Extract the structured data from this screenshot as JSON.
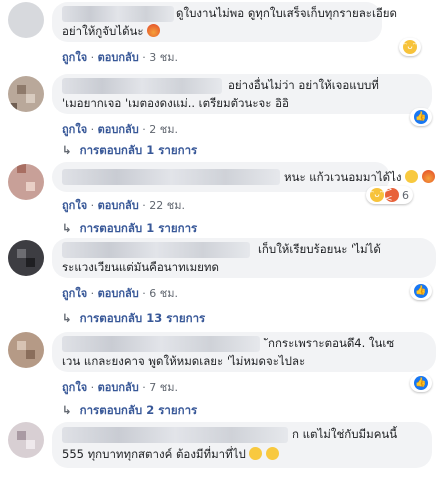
{
  "colors": {
    "link": "#385898",
    "bubble": "#f2f3f5",
    "meta": "#616770",
    "like": "#1877f2"
  },
  "comments": [
    {
      "text_lines": [
        "ดูใบงานไม่พอ ดูทุกใบเสร็จเก็บทุกรายละเอียด",
        "อย่าให้กูจับได้นะ"
      ],
      "like": "ถูกใจ",
      "reply": "ตอบกลับ",
      "time": "3 ชม.",
      "reaction_icons": [
        "haha-icon"
      ],
      "reaction_count": ""
    },
    {
      "text_lines": [
        "อย่างอื่นไม่ว่า อย่าให้เจอแบบที่",
        "'เมอยากเจอ 'เมตองดงแม่.. เตรียมตัวนะจะ อิอิ"
      ],
      "like": "ถูกใจ",
      "reply": "ตอบกลับ",
      "time": "2 ชม.",
      "reaction_icons": [
        "like-icon"
      ],
      "reaction_count": "",
      "replies": "การตอบกลับ 1 รายการ"
    },
    {
      "text_lines": [
        "หนะ แก้วเวนอมมาได้ไง"
      ],
      "like": "ถูกใจ",
      "reply": "ตอบกลับ",
      "time": "22 ชม.",
      "reaction_icons": [
        "haha-icon",
        "angry-icon"
      ],
      "reaction_count": "6",
      "replies": "การตอบกลับ 1 รายการ"
    },
    {
      "text_lines": [
        "เก็บให้เรียบร้อยนะ 'ไม่ได้",
        "ระแวงเวียนแต่มันคือนาทเมยทด"
      ],
      "like": "ถูกใจ",
      "reply": "ตอบกลับ",
      "time": "6 ชม.",
      "reaction_icons": [
        "like-icon"
      ],
      "reaction_count": "",
      "replies": "การตอบกลับ 13 รายการ"
    },
    {
      "text_lines": [
        "ักกระเพราะตอนดึ4. ในเซ",
        "เวน แกละยงคาจ พูดให้หมดเลยะ 'ไม่หมดจะไปละ"
      ],
      "like": "ถูกใจ",
      "reply": "ตอบกลับ",
      "time": "7 ชม.",
      "reaction_icons": [
        "like-icon"
      ],
      "reaction_count": "",
      "replies": "การตอบกลับ 2 รายการ"
    },
    {
      "text_lines": [
        "ก แตไม่ใช่กับมีมคนนี้",
        "555 ทุกบาททุกสตางค์ ต้องมีที่มาที่ไป"
      ],
      "like": "",
      "reply": "",
      "time": "",
      "reaction_icons": [],
      "reaction_count": ""
    }
  ]
}
